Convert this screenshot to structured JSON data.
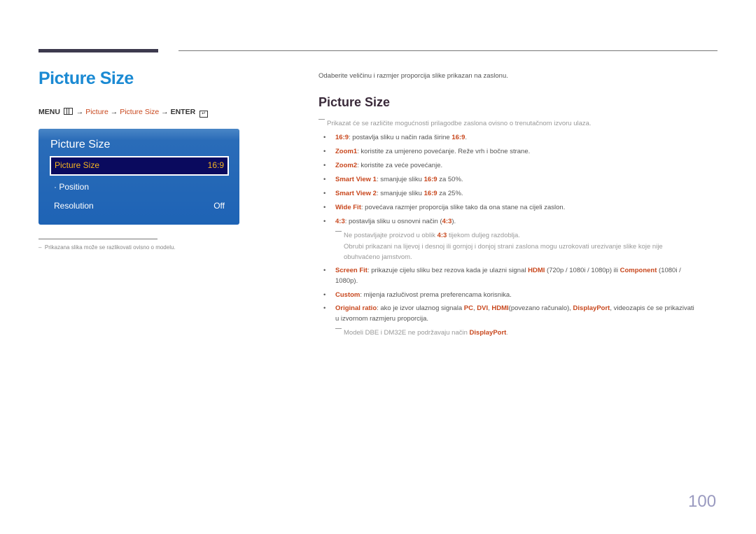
{
  "header": {
    "title": "Picture Size",
    "menu_path": {
      "menu": "MENU",
      "arrow": "→",
      "picture": "Picture",
      "picture_size": "Picture Size",
      "enter": "ENTER",
      "menu_icon": "menu-grid-icon",
      "enter_icon": "enter-return-icon"
    }
  },
  "osd": {
    "title": "Picture Size",
    "rows": [
      {
        "label": "Picture Size",
        "value": "16:9",
        "selected": true
      },
      {
        "label": "· Position",
        "value": ""
      },
      {
        "label": "Resolution",
        "value": "Off"
      }
    ],
    "colors": {
      "panel": "#1e63b5",
      "selected_bg": "#0a0a5e",
      "selected_text": "#f4b320"
    }
  },
  "left_footnote": "Prikazana slika može se razlikovati ovisno o modelu.",
  "right": {
    "intro": "Odaberite veličinu i razmjer proporcija slike prikazan na zaslonu.",
    "section_title": "Picture Size",
    "note": "Prikazat će se različite mogućnosti prilagodbe zaslona ovisno o trenutačnom izvoru ulaza.",
    "items": [
      {
        "term": "16:9",
        "p1": ": postavlja sliku u način rada širine ",
        "t2": "16:9",
        "p2": "."
      },
      {
        "term": "Zoom1",
        "p1": ": koristite za umjereno povećanje. Reže vrh i bočne strane."
      },
      {
        "term": "Zoom2",
        "p1": ": koristite za veće povećanje."
      },
      {
        "term": "Smart View 1",
        "p1": ": smanjuje sliku ",
        "t2": "16:9",
        "p2": " za 50%."
      },
      {
        "term": "Smart View 2",
        "p1": ": smanjuje sliku ",
        "t2": "16:9",
        "p2": " za 25%."
      },
      {
        "term": "Wide Fit",
        "p1": ": povećava razmjer proporcija slike tako da ona stane na cijeli zaslon."
      },
      {
        "term": "4:3",
        "p1": ": postavlja sliku u osnovni način (",
        "t2": "4:3",
        "p2": ")."
      }
    ],
    "note43": {
      "p1": "Ne postavljajte proizvod u oblik ",
      "t": "4:3",
      "p2": " tijekom duljeg razdoblja.",
      "line2": "Obrubi prikazani na lijevoj i desnoj ili gornjoj i donjoj strani zaslona mogu uzrokovati urezivanje slike koje nije",
      "line3": "obuhvaćeno jamstvom."
    },
    "screen_fit": {
      "term": "Screen Fit",
      "p1": ": prikazuje cijelu sliku bez rezova kada je ulazni signal ",
      "t2": "HDMI",
      "p2": " (720p / 1080i / 1080p) ili ",
      "t3": "Component",
      "p3": " (1080i /",
      "line2": "1080p)."
    },
    "custom": {
      "term": "Custom",
      "p1": ": mijenja razlučivost prema preferencama korisnika."
    },
    "original": {
      "term": "Original ratio",
      "p1": ": ako je izvor ulaznog signala ",
      "t2": "PC",
      "s1": ", ",
      "t3": "DVI",
      "s2": ", ",
      "t4": "HDMI",
      "p2": "(povezano računalo), ",
      "t5": "DisplayPort",
      "p3": ", videozapis će se prikazivati",
      "line2": "u izvornom razmjeru proporcija."
    },
    "note_dp": {
      "p1": "Modeli DBE i DM32E ne podržavaju način ",
      "t": "DisplayPort",
      "p2": "."
    }
  },
  "page_number": "100",
  "colors": {
    "title_blue": "#1b8ad3",
    "accent_red": "#c8471d"
  }
}
